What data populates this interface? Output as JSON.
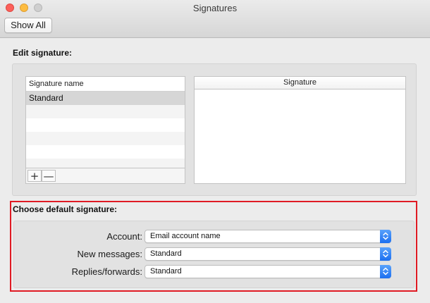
{
  "window": {
    "title": "Signatures"
  },
  "toolbar": {
    "show_all_label": "Show All"
  },
  "edit_section": {
    "label": "Edit signature:",
    "list": {
      "header": "Signature name",
      "items": [
        "Standard"
      ],
      "add_label": "+",
      "remove_label": "—"
    },
    "editor": {
      "header": "Signature"
    }
  },
  "default_section": {
    "label": "Choose default signature:",
    "fields": [
      {
        "label": "Account:",
        "value": "Email account name"
      },
      {
        "label": "New messages:",
        "value": "Standard"
      },
      {
        "label": "Replies/forwards:",
        "value": "Standard"
      }
    ]
  },
  "colors": {
    "highlight": "#e01b24",
    "accent": "#1b6ff0",
    "close": "#fc605b",
    "minimize": "#fdbc40",
    "maximize": "#cfcfcf"
  }
}
